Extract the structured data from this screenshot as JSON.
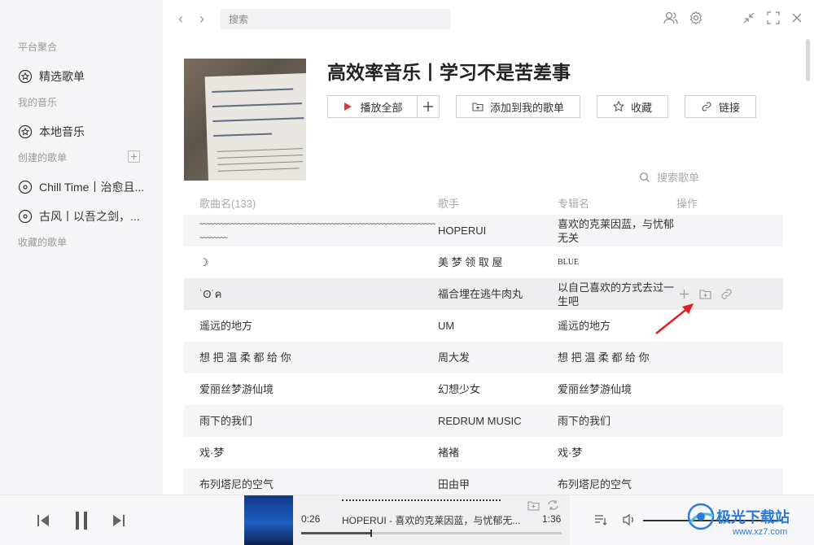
{
  "sidebar": {
    "section_platform": "平台聚合",
    "featured_playlist": "精选歌单",
    "section_my_music": "我的音乐",
    "local_music": "本地音乐",
    "section_created": "创建的歌单",
    "created_playlists": [
      {
        "label": "Chill Time丨治愈且..."
      },
      {
        "label": "古风丨以吾之剑，..."
      }
    ],
    "section_collected": "收藏的歌单"
  },
  "topbar": {
    "search_placeholder": "搜索"
  },
  "playlist": {
    "title": "高效率音乐丨学习不是苦差事",
    "play_all": "播放全部",
    "add_to_my": "添加到我的歌单",
    "collect": "收藏",
    "link": "链接",
    "search_songs": "搜索歌单"
  },
  "table": {
    "headers": {
      "name": "歌曲名(133)",
      "artist": "歌手",
      "album": "专辑名",
      "actions": "操作"
    },
    "rows": [
      {
        "name": "~~~~~~~~~~~~~~~~~~~~~~~~~~~~~~~~~~~~~~~~~~~~~~~~~~~~~~~~~~~~~~~~~~~~~~~~~~~~",
        "artist": "HOPERUI",
        "album": "喜欢的克莱因蓝，与忧郁无关"
      },
      {
        "name": "☽",
        "artist": "美 梦 领 取 屋",
        "album": "BLUE"
      },
      {
        "name": "˙ʘ˙ค",
        "artist": "福合埋在逃牛肉丸",
        "album": "以自己喜欢的方式去过一生吧"
      },
      {
        "name": "遥远的地方",
        "artist": "UM",
        "album": "遥远的地方"
      },
      {
        "name": "想 把 温 柔 都 给 你",
        "artist": "周大发",
        "album": "想 把 温 柔 都 给 你"
      },
      {
        "name": "爱丽丝梦游仙境",
        "artist": "幻想少女",
        "album": "爱丽丝梦游仙境"
      },
      {
        "name": "雨下的我们",
        "artist": "REDRUM MUSIC",
        "album": "雨下的我们"
      },
      {
        "name": "戏·梦",
        "artist": "褚褚",
        "album": "戏·梦"
      },
      {
        "name": "布列塔尼的空气",
        "artist": "田由甲",
        "album": "布列塔尼的空气"
      }
    ]
  },
  "player": {
    "current_time": "0:26",
    "total_time": "1:36",
    "now_playing": "HOPERUI - 喜欢的克莱因蓝，与忧郁无...",
    "progress": 0.27
  },
  "watermark": {
    "text": "极光下载站",
    "url": "www.xz7.com"
  },
  "colors": {
    "sidebar_bg": "#f5f5f7",
    "play_accent": "#e53935",
    "annotation_arrow": "#e02020"
  }
}
